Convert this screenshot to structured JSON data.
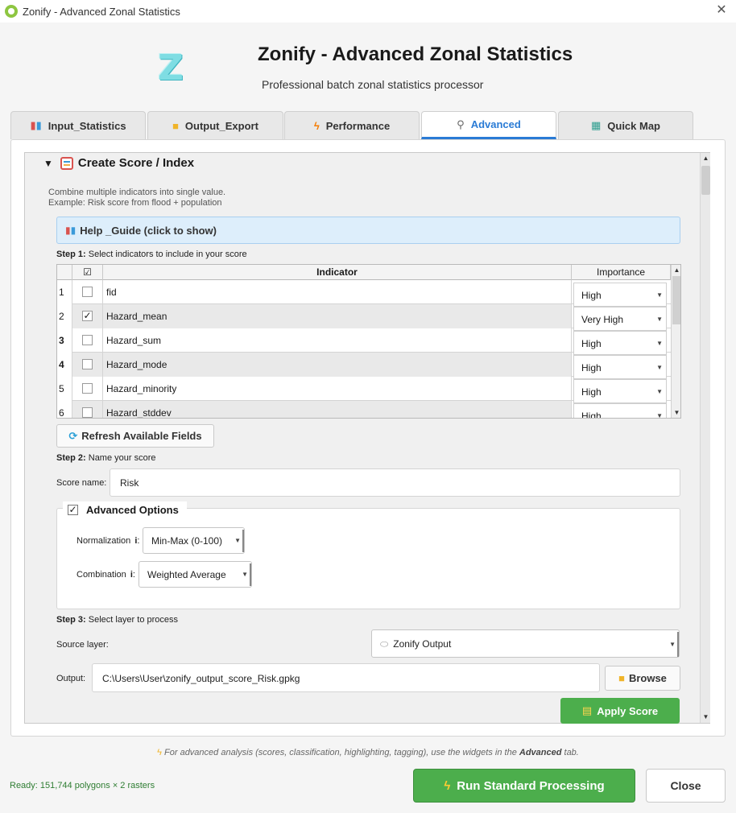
{
  "window": {
    "title": "Zonify - Advanced Zonal Statistics",
    "close_glyph": "✕"
  },
  "header": {
    "logo_letter": "Z",
    "title": "Zonify - Advanced Zonal Statistics",
    "subtitle": "Professional batch zonal statistics processor"
  },
  "tabs": [
    {
      "label": "Input_Statistics",
      "icon": "chart-icon",
      "glyph": "▮▮"
    },
    {
      "label": "Output_Export",
      "icon": "folder-icon",
      "glyph": "📁"
    },
    {
      "label": "Performance",
      "icon": "lightning-icon",
      "glyph": "⚡"
    },
    {
      "label": "Advanced",
      "icon": "microscope-icon",
      "glyph": "🔬",
      "active": true
    },
    {
      "label": "Quick Map",
      "icon": "map-icon",
      "glyph": "🗺"
    }
  ],
  "score_section": {
    "arrow": "▼",
    "title": "Create Score / Index",
    "desc_line1": "Combine multiple indicators into single value.",
    "desc_line2": "Example: Risk score from flood + population",
    "help_label": "Help _Guide (click to show)",
    "step1_bold": "Step 1:",
    "step1_text": " Select indicators to include in your score",
    "table": {
      "header_check": "☑",
      "col_indicator": "Indicator",
      "col_importance": "Importance",
      "rows": [
        {
          "num": "1",
          "checked": "",
          "indicator": "fid",
          "importance": "High"
        },
        {
          "num": "2",
          "checked": "✓",
          "indicator": "Hazard_mean",
          "importance": "Very High"
        },
        {
          "num": "3",
          "checked": "",
          "indicator": "Hazard_sum",
          "importance": "High"
        },
        {
          "num": "4",
          "checked": "",
          "indicator": "Hazard_mode",
          "importance": "High"
        },
        {
          "num": "5",
          "checked": "",
          "indicator": "Hazard_minority",
          "importance": "High"
        },
        {
          "num": "6",
          "checked": "",
          "indicator": "Hazard_stddev",
          "importance": "High"
        }
      ]
    },
    "refresh_label": "Refresh Available Fields",
    "step2_bold": "Step 2:",
    "step2_text": " Name your score",
    "score_name_label": "Score name:",
    "score_name_value": "Risk",
    "advanced_options": {
      "checked": "✓",
      "title": "Advanced Options",
      "normalization_label": "Normalization",
      "normalization_info": "i",
      "normalization_value": "Min-Max (0-100)",
      "combination_label": "Combination",
      "combination_info": "i",
      "combination_value": "Weighted Average"
    },
    "step3_bold": "Step 3:",
    "step3_text": " Select layer to process",
    "source_layer_label": "Source layer:",
    "source_layer_value": "Zonify Output",
    "output_label": "Output:",
    "output_value": "C:\\Users\\User\\zonify_output_score_Risk.gpkg",
    "browse_label": "Browse",
    "apply_label": "Apply Score"
  },
  "footer": {
    "note_prefix": "For advanced analysis (scores, classification, highlighting, tagging), use the widgets in the ",
    "note_bold": "Advanced",
    "note_suffix": " tab.",
    "status": "Ready: 151,744 polygons × 2 rasters",
    "run_label": "Run Standard Processing",
    "close_label": "Close"
  },
  "colors": {
    "accent": "#2a7bd5",
    "green": "#4cae4c",
    "status_green": "#2e7d32"
  }
}
